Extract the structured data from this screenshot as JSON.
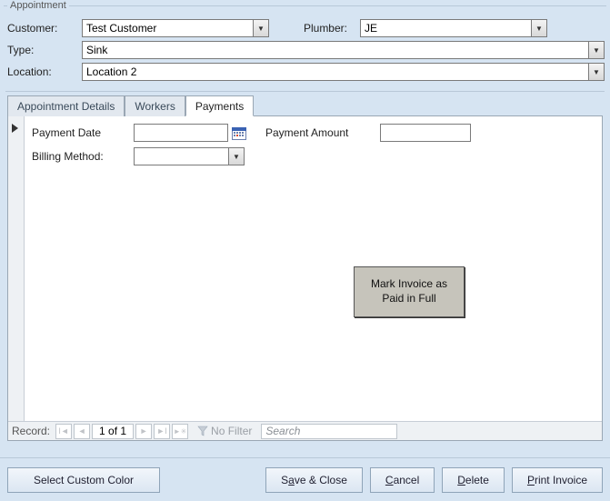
{
  "group_title": "Appointment",
  "header": {
    "customer_label": "Customer:",
    "customer_value": "Test Customer",
    "plumber_label": "Plumber:",
    "plumber_value": "JE",
    "type_label": "Type:",
    "type_value": "Sink",
    "location_label": "Location:",
    "location_value": "Location 2"
  },
  "tabs": {
    "details": "Appointment Details",
    "workers": "Workers",
    "payments": "Payments",
    "active": "payments"
  },
  "payments": {
    "payment_date_label": "Payment Date",
    "payment_date_value": "",
    "payment_amount_label": "Payment Amount",
    "payment_amount_value": "",
    "billing_method_label": "Billing Method:",
    "billing_method_value": "",
    "mark_paid_button_line1": "Mark Invoice as",
    "mark_paid_button_line2": "Paid in Full"
  },
  "recordnav": {
    "label": "Record:",
    "position": "1 of 1",
    "no_filter": "No Filter",
    "search_placeholder": "Search"
  },
  "buttons": {
    "select_color": "Select Custom Color",
    "save_close_pre": "S",
    "save_close_ul": "a",
    "save_close_post": "ve & Close",
    "cancel_ul": "C",
    "cancel_post": "ancel",
    "delete_ul": "D",
    "delete_post": "elete",
    "print_ul": "P",
    "print_post": "rint Invoice"
  }
}
